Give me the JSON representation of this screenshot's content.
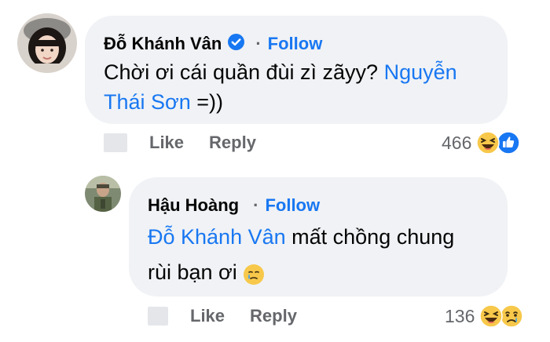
{
  "comments": [
    {
      "author": "Đỗ Khánh Vân",
      "verified": true,
      "follow_label": "Follow",
      "separator": "·",
      "text_line1": "Chời ơi cái quần đùi zì zãyy? ",
      "mention_line1": "Nguyễn",
      "mention_line2": "Thái Sơn",
      "text_line2": " =))",
      "like_label": "Like",
      "reply_label": "Reply",
      "reaction_count": "466",
      "reaction_icons": [
        "haha-icon",
        "like-icon"
      ]
    },
    {
      "author": "Hậu Hoàng",
      "verified": false,
      "follow_label": "Follow",
      "separator": "·",
      "mention": "Đỗ Khánh Vân",
      "text_line1": " mất chồng chung",
      "text_line2": "rùi bạn ơi ",
      "emoji": "crying-face",
      "like_label": "Like",
      "reply_label": "Reply",
      "reaction_count": "136",
      "reaction_icons": [
        "haha-icon",
        "sad-icon"
      ]
    }
  ],
  "colors": {
    "bubble": "#f0f2f5",
    "link": "#1877f2",
    "secondary": "#65676b"
  }
}
